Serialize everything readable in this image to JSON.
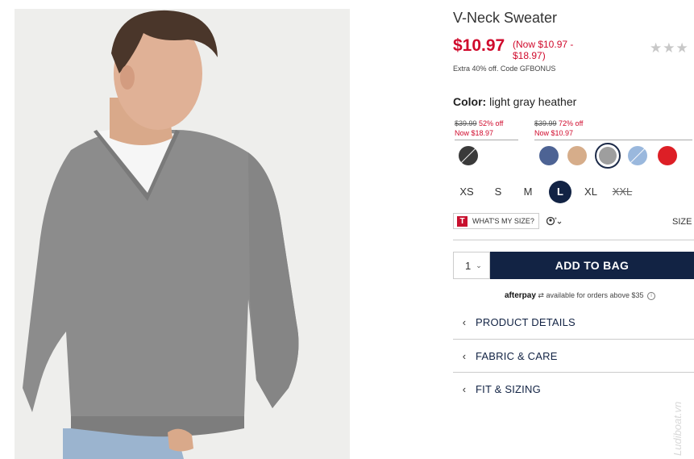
{
  "product": {
    "title": "V-Neck Sweater",
    "price": "$10.97",
    "price_range": "(Now $10.97 - $18.97)",
    "stars": "★★★",
    "promo": "Extra 40% off. Code GFBONUS"
  },
  "color": {
    "label": "Color:",
    "value": "light gray heather",
    "groups": [
      {
        "was": "$39.99",
        "off": "52% off",
        "now": "Now $18.97"
      },
      {
        "was": "$39.99",
        "off": "72% off",
        "now": "Now $10.97"
      }
    ],
    "swatches": [
      {
        "name": "charcoal",
        "color": "#3a3a3a",
        "unavailable": true
      },
      {
        "name": "navy",
        "color": "#4d6394",
        "unavailable": false
      },
      {
        "name": "tan",
        "color": "#d6ad8a",
        "unavailable": false
      },
      {
        "name": "light gray heather",
        "color": "#9e9e9e",
        "selected": true
      },
      {
        "name": "light blue",
        "color": "#9ab8dd",
        "unavailable": true
      },
      {
        "name": "red",
        "color": "#dd1f26",
        "unavailable": false
      }
    ]
  },
  "sizes": [
    "XS",
    "S",
    "M",
    "L",
    "XL",
    "XXL"
  ],
  "selected_size": "L",
  "unavailable_size": "XXL",
  "fit": {
    "whats_my_size": "WHAT'S MY SIZE?",
    "t_badge": "T",
    "size_label": "SIZE"
  },
  "cart": {
    "quantity": "1",
    "add_to_bag": "ADD TO BAG"
  },
  "afterpay": {
    "logo": "afterpay",
    "text": "available for orders above $35"
  },
  "accordions": [
    "PRODUCT DETAILS",
    "FABRIC & CARE",
    "FIT & SIZING"
  ],
  "watermark": "Ludiboat.vn",
  "colors": {
    "accent_red": "#d00a2c",
    "navy": "#122344"
  }
}
